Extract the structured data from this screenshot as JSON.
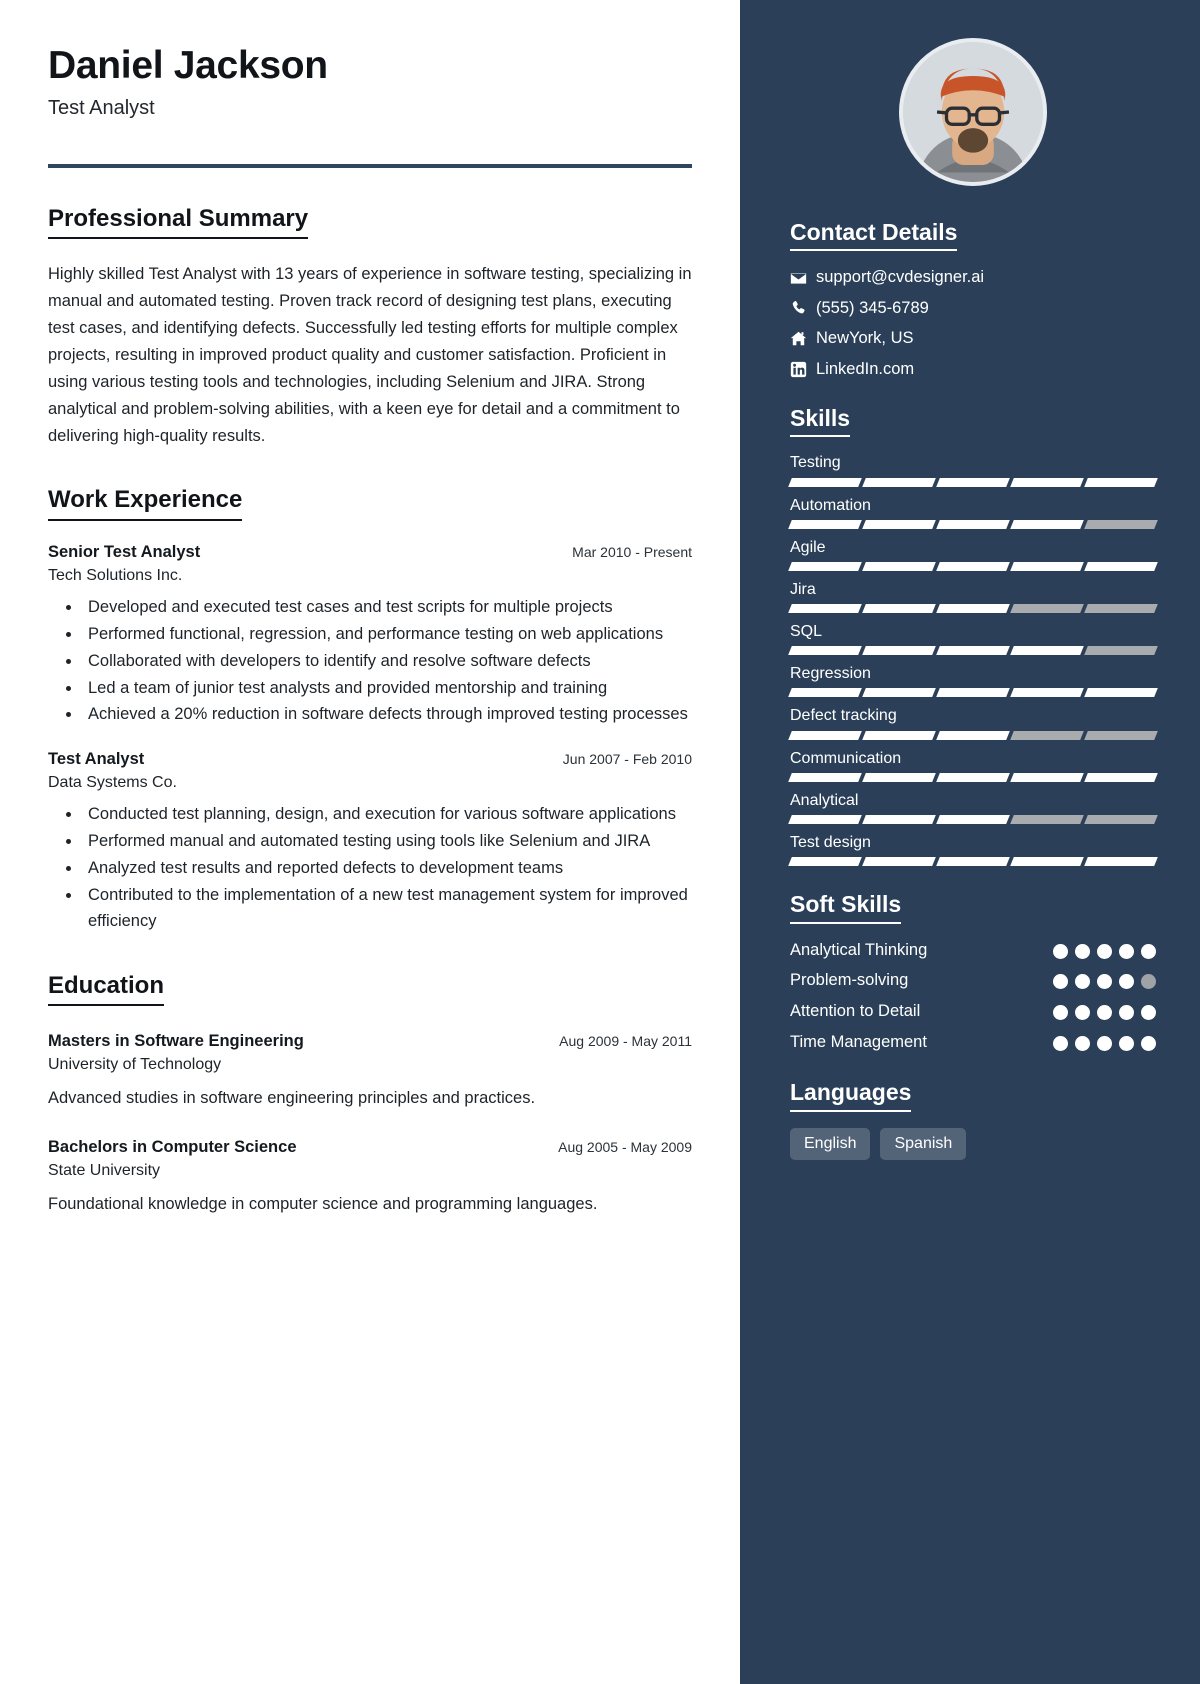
{
  "theme": {
    "sidebar_bg": "#2b4058",
    "accent_rule": "#2e465e",
    "text_dark": "#1d2328",
    "bar_on": "#ffffff",
    "bar_off": "#a9acaf",
    "chip_bg": "#536479"
  },
  "header": {
    "name": "Daniel Jackson",
    "title": "Test Analyst"
  },
  "summary": {
    "heading": "Professional Summary",
    "text": "Highly skilled Test Analyst with 13 years of experience in software testing, specializing in manual and automated testing. Proven track record of designing test plans, executing test cases, and identifying defects. Successfully led testing efforts for multiple complex projects, resulting in improved product quality and customer satisfaction. Proficient in using various testing tools and technologies, including Selenium and JIRA. Strong analytical and problem-solving abilities, with a keen eye for detail and a commitment to delivering high-quality results."
  },
  "work": {
    "heading": "Work Experience",
    "entries": [
      {
        "role": "Senior Test Analyst",
        "date": "Mar 2010 - Present",
        "org": "Tech Solutions Inc.",
        "bullets": [
          "Developed and executed test cases and test scripts for multiple projects",
          "Performed functional, regression, and performance testing on web applications",
          "Collaborated with developers to identify and resolve software defects",
          "Led a team of junior test analysts and provided mentorship and training",
          "Achieved a 20% reduction in software defects through improved testing processes"
        ]
      },
      {
        "role": "Test Analyst",
        "date": "Jun 2007 - Feb 2010",
        "org": "Data Systems Co.",
        "bullets": [
          "Conducted test planning, design, and execution for various software applications",
          "Performed manual and automated testing using tools like Selenium and JIRA",
          "Analyzed test results and reported defects to development teams",
          "Contributed to the implementation of a new test management system for improved efficiency"
        ]
      }
    ]
  },
  "education": {
    "heading": "Education",
    "entries": [
      {
        "degree": "Masters in Software Engineering",
        "date": "Aug 2009 - May 2011",
        "school": "University of Technology",
        "desc": "Advanced studies in software engineering principles and practices."
      },
      {
        "degree": "Bachelors in Computer Science",
        "date": "Aug 2005 - May 2009",
        "school": "State University",
        "desc": "Foundational knowledge in computer science and programming languages."
      }
    ]
  },
  "contact": {
    "heading": "Contact Details",
    "items": [
      {
        "icon": "envelope-icon",
        "text": "support@cvdesigner.ai"
      },
      {
        "icon": "phone-icon",
        "text": "(555) 345-6789"
      },
      {
        "icon": "home-icon",
        "text": "NewYork, US"
      },
      {
        "icon": "linkedin-icon",
        "text": "LinkedIn.com"
      }
    ]
  },
  "skills": {
    "heading": "Skills",
    "segments_total": 5,
    "items": [
      {
        "name": "Testing",
        "filled": 5
      },
      {
        "name": "Automation",
        "filled": 4
      },
      {
        "name": "Agile",
        "filled": 5
      },
      {
        "name": "Jira",
        "filled": 3
      },
      {
        "name": "SQL",
        "filled": 4
      },
      {
        "name": "Regression",
        "filled": 5
      },
      {
        "name": "Defect tracking",
        "filled": 3
      },
      {
        "name": "Communication",
        "filled": 5
      },
      {
        "name": "Analytical",
        "filled": 3
      },
      {
        "name": "Test design",
        "filled": 5
      }
    ]
  },
  "soft_skills": {
    "heading": "Soft Skills",
    "dots_total": 5,
    "items": [
      {
        "name": "Analytical Thinking",
        "filled": 5
      },
      {
        "name": "Problem-solving",
        "filled": 4
      },
      {
        "name": "Attention to Detail",
        "filled": 5
      },
      {
        "name": "Time Management",
        "filled": 5
      }
    ]
  },
  "languages": {
    "heading": "Languages",
    "items": [
      "English",
      "Spanish"
    ]
  }
}
